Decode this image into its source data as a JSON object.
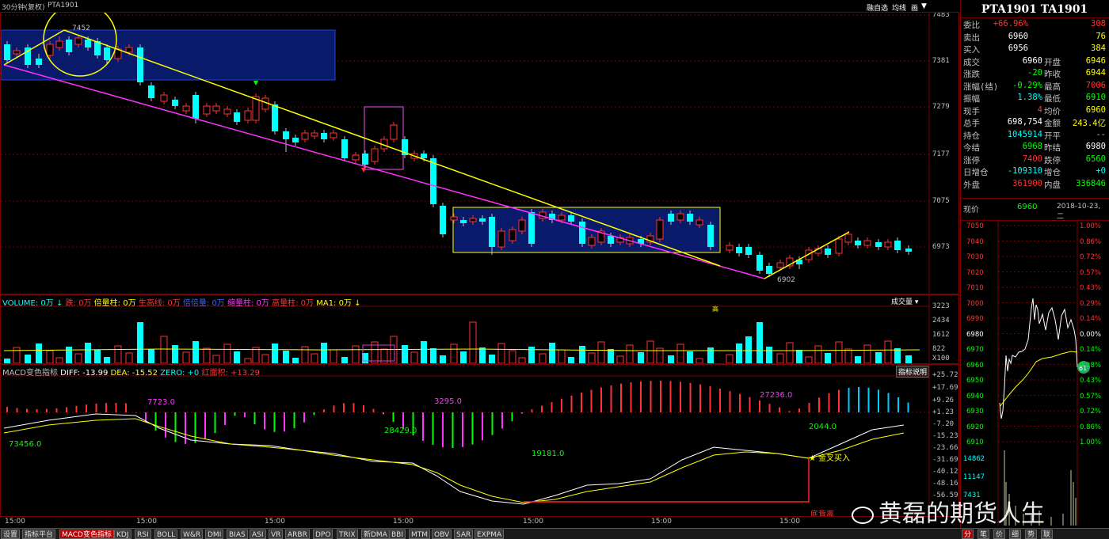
{
  "header": {
    "period_label": "30分钟(复权)",
    "symbol": "PTA1901",
    "controls": [
      "融自选",
      "均线",
      "画",
      "▼"
    ]
  },
  "price_axis": [
    "7483",
    "7381",
    "7279",
    "7177",
    "7075",
    "6973"
  ],
  "annotations": {
    "high_mark": "7452",
    "low_mark": "6902"
  },
  "volume_panel": {
    "label_volume": "VOLUME: 0万",
    "label_down": "跌: 0万",
    "label_double": "倍量柱: 0万",
    "label_high": "生高线: 0万",
    "label_beiyang": "倍倍量: 0万",
    "label_shrink": "缩量柱: 0万",
    "label_highvol": "高量柱: 0万",
    "label_ma": "MA1: 0万",
    "dropdown": "成交量",
    "axis": [
      "3223",
      "2434",
      "1612",
      "822",
      "X100"
    ],
    "high_tag": "高"
  },
  "macd_panel": {
    "title": "MACD变色指标",
    "diff": "DIFF: -13.99",
    "dea": "DEA: -15.52",
    "zero": "ZERO: +0",
    "red_area": "红面积: +13.29",
    "button": "指标说明",
    "axis": [
      "+25.72",
      "+17.69",
      "+9.26",
      "+1.23",
      "-7.20",
      "-15.23",
      "-23.66",
      "-31.69",
      "-40.12",
      "-48.16",
      "-56.59"
    ],
    "labels": [
      "7723.0",
      "3295.0",
      "27236.0",
      "73456.0",
      "28429.0",
      "2044.0",
      "19181.0"
    ],
    "golden_cross": "金叉买入",
    "divergence": "底背离"
  },
  "time_axis": [
    "15:00",
    "15:00",
    "15:00",
    "15:00",
    "15:00",
    "15:00",
    "15:00"
  ],
  "bottom_tabs": [
    "设置",
    "指标平台",
    "MACD变色指标",
    "KDJ",
    "RSI",
    "BOLL",
    "W&R",
    "DMI",
    "BIAS",
    "ASI",
    "VR",
    "ARBR",
    "DPO",
    "TRIX",
    "新DMA",
    "BBI",
    "MTM",
    "OBV",
    "SAR",
    "EXPMA"
  ],
  "quote": {
    "title": "PTA1901 TA1901",
    "rows": [
      {
        "k1": "委比",
        "v1": "+66.96%",
        "v1c": "#ff3333",
        "v2": "308",
        "v2c": "#ff3333"
      },
      {
        "k1": "卖出",
        "v1": "6960",
        "v1c": "#ffffff",
        "v2": "76",
        "v2c": "#ffff00"
      },
      {
        "k1": "买入",
        "v1": "6956",
        "v1c": "#ffffff",
        "v2": "384",
        "v2c": "#ffff00"
      },
      {
        "k1": "成交",
        "v1": "6960",
        "v1c": "#ffffff",
        "k2": "开盘",
        "v2": "6946",
        "v2c": "#ffff00"
      },
      {
        "k1": "涨跌",
        "v1": "-20",
        "v1c": "#00ff00",
        "k2": "昨收",
        "v2": "6944",
        "v2c": "#ffff00"
      },
      {
        "k1": "涨幅(结)",
        "v1": "-0.29%",
        "v1c": "#00ff00",
        "k2": "最高",
        "v2": "7006",
        "v2c": "#ff3333"
      },
      {
        "k1": "振幅",
        "v1": "1.38%",
        "v1c": "#00ffff",
        "k2": "最低",
        "v2": "6910",
        "v2c": "#00ff00"
      },
      {
        "k1": "现手",
        "v1": "4",
        "v1c": "#ff3333",
        "k2": "均价",
        "v2": "6960",
        "v2c": "#ffff00"
      },
      {
        "k1": "总手",
        "v1": "698,754",
        "v1c": "#ffffff",
        "k2": "金额",
        "v2": "243.4亿",
        "v2c": "#ffff00"
      },
      {
        "k1": "持仓",
        "v1": "1045914",
        "v1c": "#00ffff",
        "k2": "开平",
        "v2": "--",
        "v2c": "#c0c0c0"
      },
      {
        "k1": "今结",
        "v1": "6968",
        "v1c": "#00ff00",
        "k2": "昨结",
        "v2": "6980",
        "v2c": "#ffffff"
      },
      {
        "k1": "涨停",
        "v1": "7400",
        "v1c": "#ff3333",
        "k2": "跌停",
        "v2": "6560",
        "v2c": "#00ff00"
      },
      {
        "k1": "日增仓",
        "v1": "-109310",
        "v1c": "#00ffff",
        "k2": "增仓",
        "v2": "+0",
        "v2c": "#00ffff"
      },
      {
        "k1": "外盘",
        "v1": "361900",
        "v1c": "#ff3333",
        "k2": "内盘",
        "v2": "336846",
        "v2c": "#00ff00"
      }
    ],
    "now_label": "现价",
    "now_price": "6960",
    "date": "2018-10-23,二"
  },
  "mini_chart": {
    "left_axis": [
      "7050",
      "7040",
      "7030",
      "7020",
      "7010",
      "7000",
      "6990",
      "6980",
      "6970",
      "6960",
      "6950",
      "6940",
      "6930",
      "6920",
      "6910"
    ],
    "right_axis": [
      "1.00%",
      "0.86%",
      "0.72%",
      "0.57%",
      "0.43%",
      "0.29%",
      "0.14%",
      "0.00%",
      "0.14%",
      "0.28%",
      "0.43%",
      "0.57%",
      "0.72%",
      "0.86%",
      "1.00%"
    ],
    "vol_axis": [
      "14862",
      "11147",
      "7431"
    ],
    "bottom_tabs": [
      "分",
      "笔",
      "价",
      "细",
      "势",
      "联"
    ]
  },
  "watermark": "黄磊的期货人生"
}
